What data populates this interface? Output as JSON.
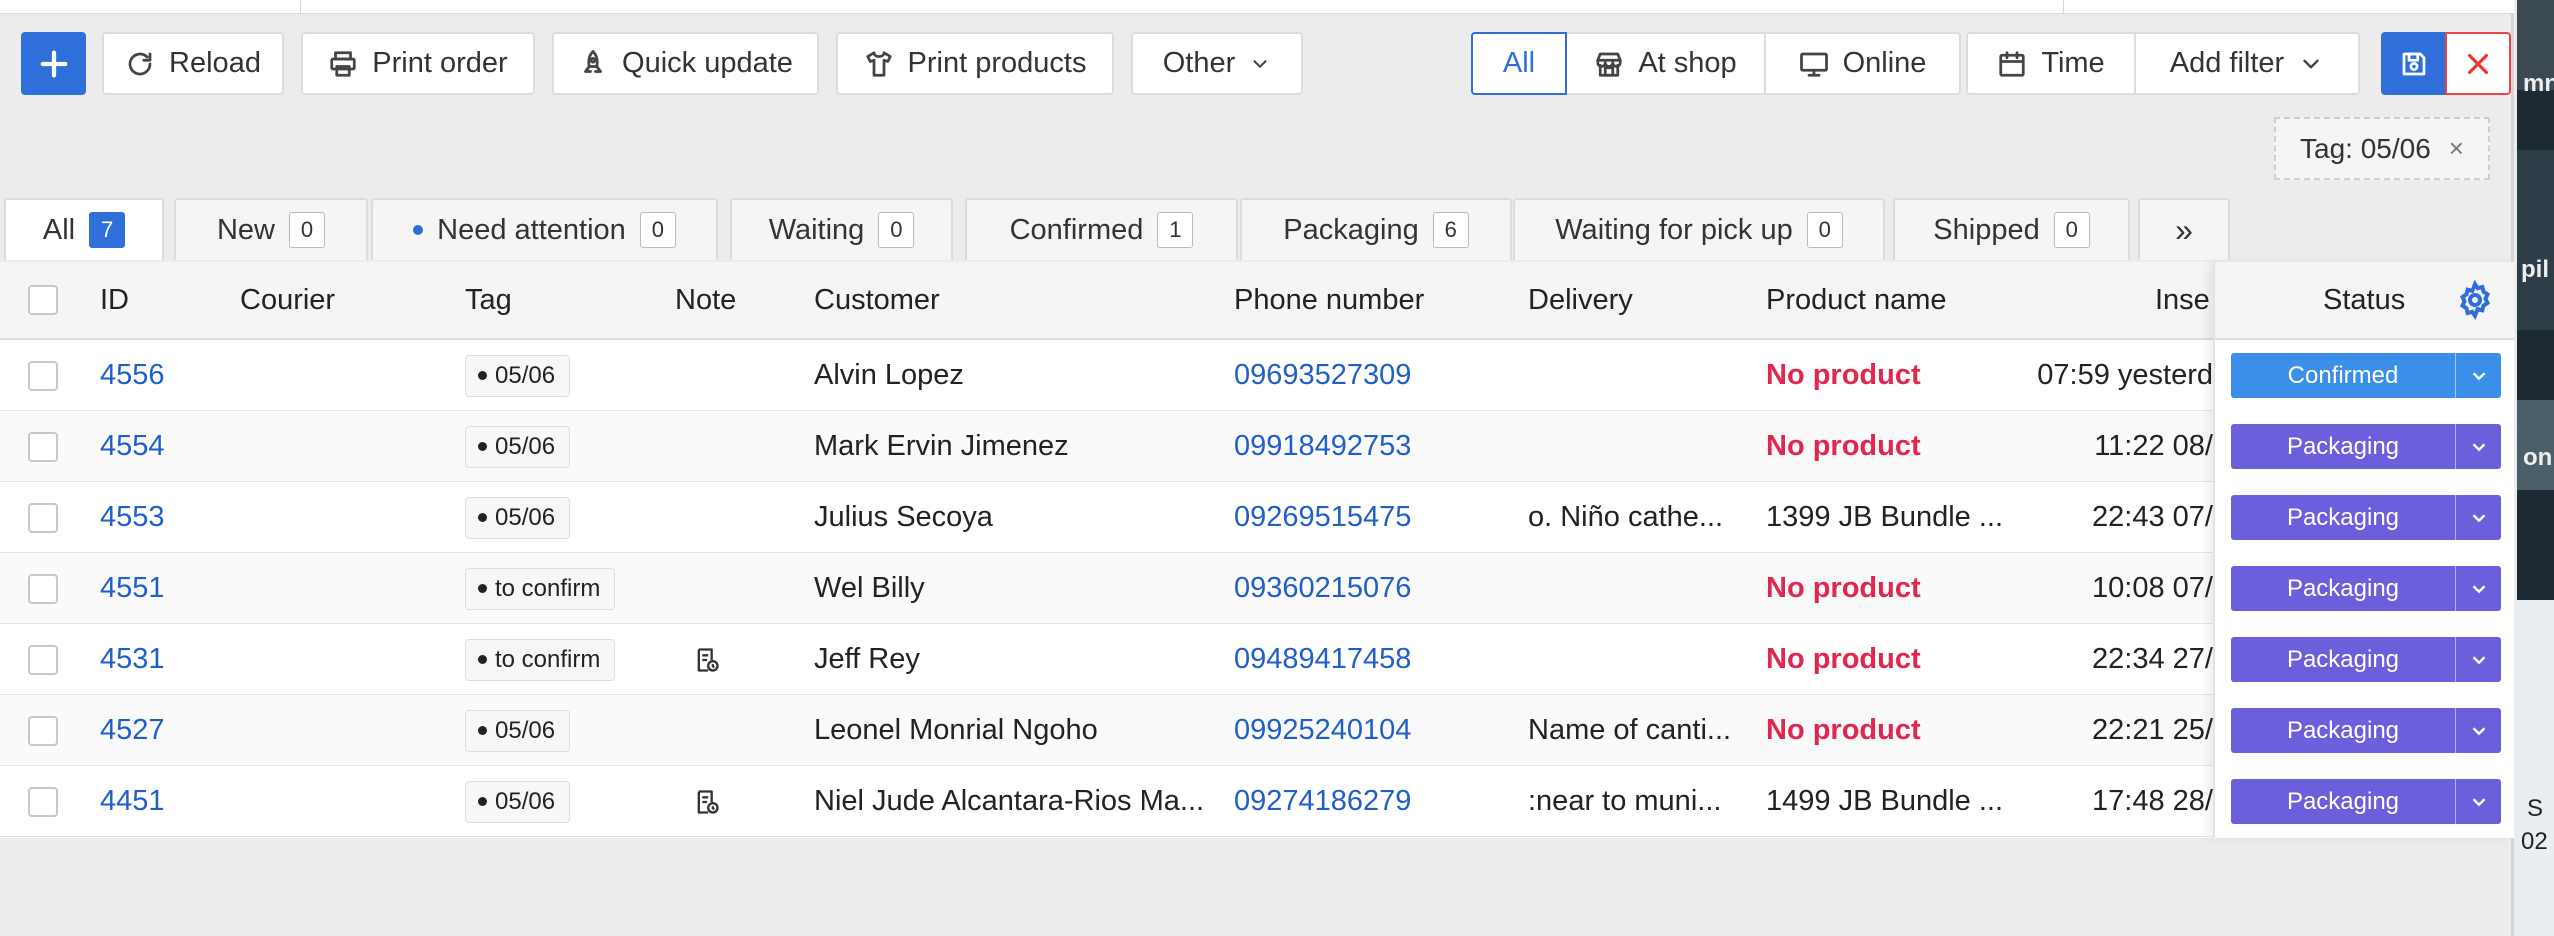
{
  "toolbar": {
    "reload": "Reload",
    "print_order": "Print order",
    "quick_update": "Quick update",
    "print_products": "Print products",
    "other": "Other",
    "channel": [
      "All",
      "At shop",
      "Online"
    ],
    "time": "Time",
    "add_filter": "Add filter"
  },
  "active_filter": {
    "label": "Tag: 05/06",
    "remove": "×"
  },
  "tabs": [
    {
      "label": "All",
      "count": "7"
    },
    {
      "label": "New",
      "count": "0"
    },
    {
      "label": "Need attention",
      "count": "0"
    },
    {
      "label": "Waiting",
      "count": "0"
    },
    {
      "label": "Confirmed",
      "count": "1"
    },
    {
      "label": "Packaging",
      "count": "6"
    },
    {
      "label": "Waiting for pick up",
      "count": "0"
    },
    {
      "label": "Shipped",
      "count": "0"
    }
  ],
  "tabs_more": "»",
  "columns": {
    "id": "ID",
    "courier": "Courier",
    "tag": "Tag",
    "note": "Note",
    "customer": "Customer",
    "phone": "Phone number",
    "delivery": "Delivery",
    "product": "Product name",
    "inserted": "Inse",
    "status": "Status"
  },
  "rows": [
    {
      "id": "4556",
      "tag": "05/06",
      "note": false,
      "customer": "Alvin Lopez",
      "phone": "09693527309",
      "delivery": "",
      "product": "No product",
      "product_missing": true,
      "inserted": "07:59 yesterd",
      "status": "Confirmed"
    },
    {
      "id": "4554",
      "tag": "05/06",
      "note": false,
      "customer": "Mark Ervin Jimenez",
      "phone": "09918492753",
      "delivery": "",
      "product": "No product",
      "product_missing": true,
      "inserted": "11:22 08/",
      "status": "Packaging"
    },
    {
      "id": "4553",
      "tag": "05/06",
      "note": false,
      "customer": "Julius Secoya",
      "phone": "09269515475",
      "delivery": "o. Niño cathe...",
      "product": "1399 JB Bundle ...",
      "product_missing": false,
      "inserted": "22:43 07/",
      "status": "Packaging"
    },
    {
      "id": "4551",
      "tag": "to confirm",
      "note": false,
      "customer": "Wel Billy",
      "phone": "09360215076",
      "delivery": "",
      "product": "No product",
      "product_missing": true,
      "inserted": "10:08 07/",
      "status": "Packaging"
    },
    {
      "id": "4531",
      "tag": "to confirm",
      "note": true,
      "customer": "Jeff Rey",
      "phone": "09489417458",
      "delivery": "",
      "product": "No product",
      "product_missing": true,
      "inserted": "22:34 27/",
      "status": "Packaging"
    },
    {
      "id": "4527",
      "tag": "05/06",
      "note": false,
      "customer": "Leonel Monrial Ngoho",
      "phone": "09925240104",
      "delivery": "Name of canti...",
      "product": "No product",
      "product_missing": true,
      "inserted": "22:21 25/",
      "status": "Packaging"
    },
    {
      "id": "4451",
      "tag": "05/06",
      "note": true,
      "customer": "Niel Jude Alcantara-Rios Ma...",
      "phone": "09274186279",
      "delivery": ":near to muni...",
      "product": "1499 JB Bundle ...",
      "product_missing": false,
      "inserted": "17:48 28/",
      "status": "Packaging"
    }
  ],
  "background_fragments": [
    "mn",
    "pil",
    "on",
    "S",
    "02"
  ]
}
